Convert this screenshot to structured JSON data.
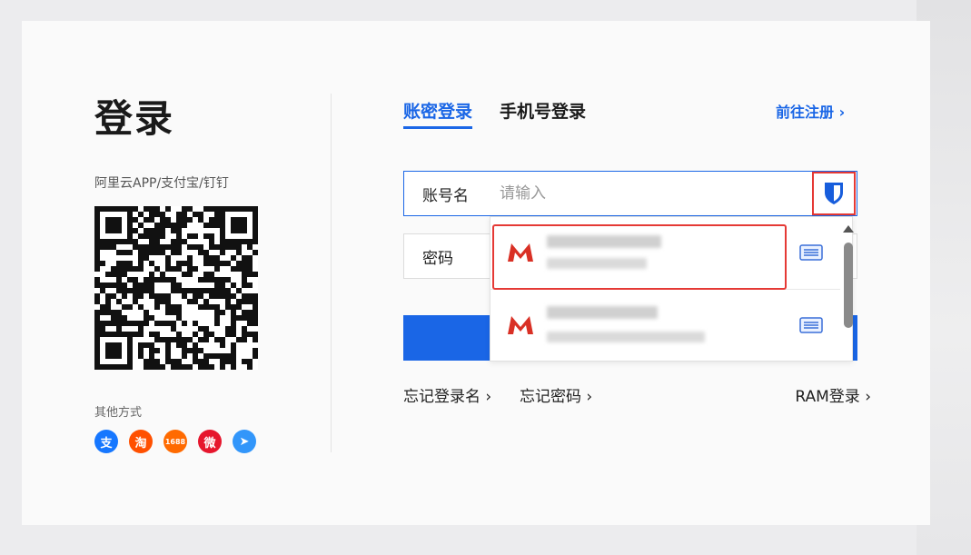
{
  "left": {
    "title": "登录",
    "scan_hint": "阿里云APP/支付宝/钉钉",
    "other_label": "其他方式",
    "social_logins": [
      {
        "name": "alipay",
        "glyph": "支",
        "color": "#1677ff"
      },
      {
        "name": "taobao",
        "glyph": "淘",
        "color": "#ff5000"
      },
      {
        "name": "1688",
        "glyph": "1688",
        "color": "#ff6a00"
      },
      {
        "name": "weibo",
        "glyph": "微",
        "color": "#e6162d"
      },
      {
        "name": "dingtalk",
        "glyph": "➤",
        "color": "#3296fa"
      }
    ]
  },
  "tabs": [
    {
      "label": "账密登录",
      "active": true
    },
    {
      "label": "手机号登录",
      "active": false
    }
  ],
  "register_link": "前往注册 ›",
  "form": {
    "username_label": "账号名",
    "username_placeholder": "请输入",
    "password_label": "密码",
    "password_placeholder": ""
  },
  "links": {
    "forgot_username": "忘记登录名 ›",
    "forgot_password": "忘记密码 ›",
    "ram_login": "RAM登录 ›"
  },
  "autofill_dropdown": {
    "items": [
      {
        "title": "",
        "subtitle": ""
      },
      {
        "title": "",
        "subtitle": ""
      }
    ]
  },
  "colors": {
    "accent": "#1a66e6",
    "highlight": "#e53935",
    "gmail_red": "#d93025",
    "bitwarden_blue": "#175ddc"
  },
  "icons": [
    "bitwarden-shield-icon",
    "gmail-icon",
    "details-icon",
    "qr-code"
  ]
}
